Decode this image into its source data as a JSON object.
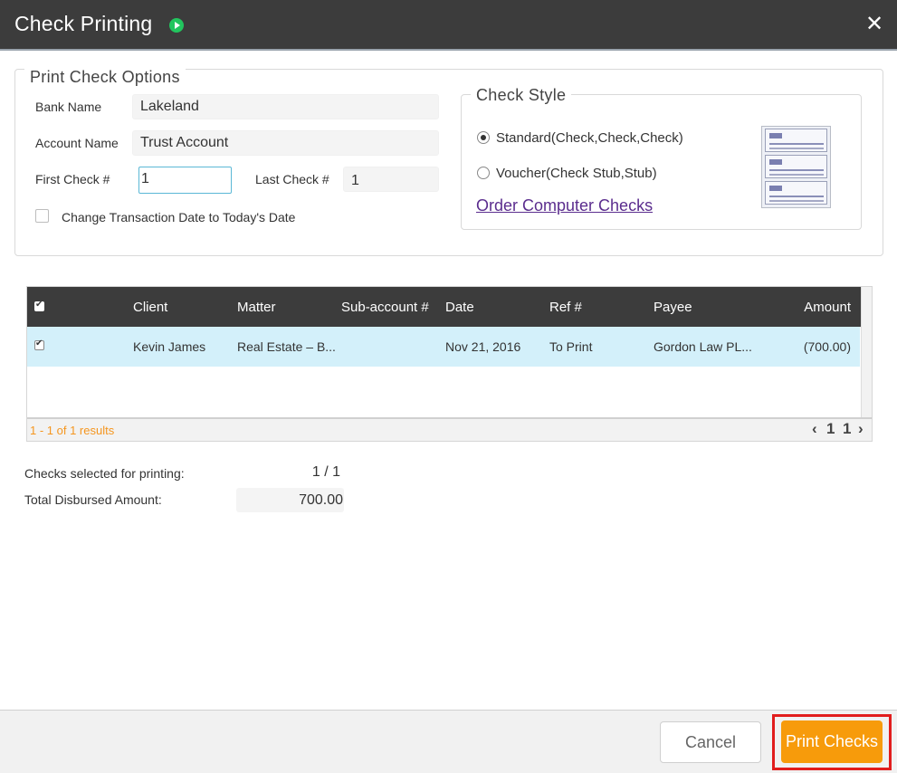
{
  "dialog": {
    "title": "Check Printing"
  },
  "options": {
    "legend": "Print Check Options",
    "bank_label": "Bank Name",
    "bank_value": "Lakeland",
    "account_label": "Account Name",
    "account_value": "Trust Account",
    "first_label": "First Check #",
    "first_value": "1",
    "last_label": "Last Check #",
    "last_value": "1",
    "change_date_label": "Change Transaction Date to Today's Date"
  },
  "check_style": {
    "legend": "Check Style",
    "standard_label": "Standard(Check,Check,Check)",
    "voucher_label": "Voucher(Check Stub,Stub)",
    "selected": "standard",
    "order_link": "Order Computer Checks"
  },
  "grid": {
    "headers": {
      "client": "Client",
      "matter": "Matter",
      "subaccount": "Sub-account #",
      "date": "Date",
      "ref": "Ref #",
      "payee": "Payee",
      "amount": "Amount"
    },
    "rows": [
      {
        "client": "Kevin James",
        "matter": "Real Estate – B...",
        "subaccount": "",
        "date": "Nov 21, 2016",
        "ref": "To Print",
        "payee": "Gordon Law PL...",
        "amount": "(700.00)"
      }
    ],
    "results_text": "1 - 1 of 1 results",
    "pager": {
      "prev": "‹",
      "page": "1",
      "total": "1",
      "next": "›"
    }
  },
  "summary": {
    "selected_label": "Checks selected for printing:",
    "selected_value": "1 / 1",
    "total_label": "Total Disbursed Amount:",
    "total_value": "700.00"
  },
  "footer": {
    "cancel_label": "Cancel",
    "print_label": "Print Checks"
  },
  "colors": {
    "header_dark": "#3c3c3c",
    "row_highlight": "#d3f0fa",
    "accent_orange": "#f79b0b",
    "results_orange": "#f5961f",
    "link_purple": "#5b2d8e",
    "callout_red": "#e11d1d"
  },
  "icons": {
    "play": "play-circle-icon",
    "close": "close-icon"
  }
}
